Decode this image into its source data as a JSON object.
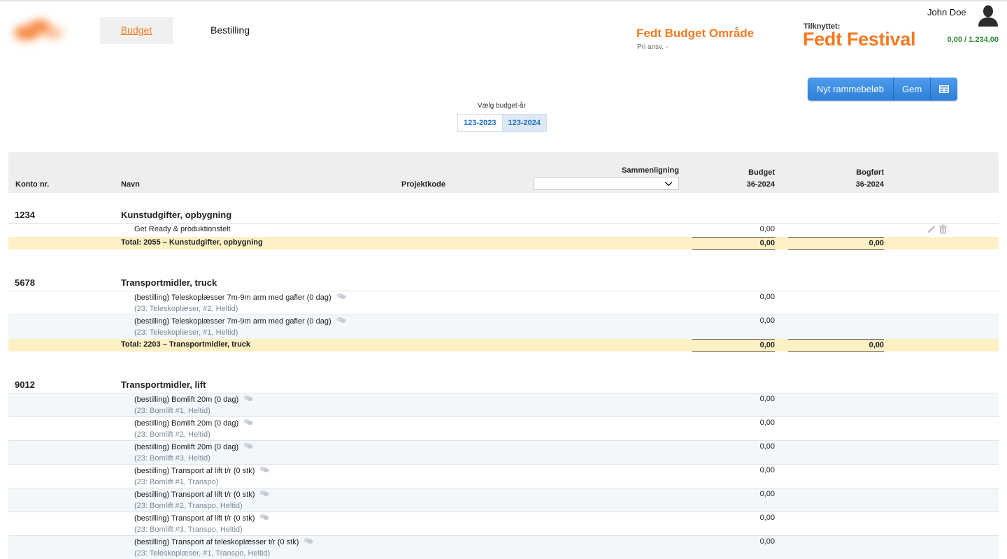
{
  "nav": {
    "tabs": [
      {
        "label": "Budget"
      },
      {
        "label": "Bestilling"
      }
    ]
  },
  "area": {
    "title": "Fedt Budget Område",
    "subtitle": "Pri ansv. -"
  },
  "attached": {
    "label": "Tilknyttet:",
    "name": "Fedt Festival"
  },
  "user": {
    "name": "John Doe",
    "amount": "0,00 / 1.234,00"
  },
  "toolbar": {
    "new_label": "Nyt rammebeløb",
    "save_label": "Gem",
    "table_icon": "table-icon"
  },
  "year": {
    "label": "Vælg budget-år",
    "options": [
      {
        "label": "123-2023"
      },
      {
        "label": "123-2024"
      }
    ],
    "selected": "123-2024"
  },
  "table": {
    "headers": {
      "konto": "Konto nr.",
      "navn": "Navn",
      "projektkode": "Projektkode",
      "sammenligning": "Sammenligning",
      "budget": "Budget",
      "budget_period": "36-2024",
      "bogfort": "Bogført",
      "bogfort_period": "36-2024"
    },
    "comparison_value": "",
    "groups": [
      {
        "no": "1234",
        "name": "Kunstudgifter, opbygning",
        "items": [
          {
            "text": "Get Ready & produktionstelt",
            "value": "0,00"
          }
        ],
        "total": {
          "label": "Total: 2055 – Kunstudgifter, opbygning",
          "budget": "0,00",
          "bogfort": "0,00"
        }
      },
      {
        "no": "5678",
        "name": "Transportmidler, truck",
        "items": [
          {
            "text": "(bestilling) Teleskoplæsser 7m-9m arm med gafler (0 dag)",
            "sub": "(23: Teleskoplæser, #2, Heltid)",
            "value": "0,00"
          },
          {
            "text": "(bestilling) Teleskoplæsser 7m-9m arm med gafler (0 dag)",
            "sub": "(23: Teleskoplæser, #1, Heltid)",
            "value": "0,00"
          }
        ],
        "total": {
          "label": "Total: 2203 – Transportmidler, truck",
          "budget": "0,00",
          "bogfort": "0,00"
        }
      },
      {
        "no": "9012",
        "name": "Transportmidler, lift",
        "items": [
          {
            "text": "(bestilling) Bomlift 20m (0 dag)",
            "sub": "(23: Bomlift #1, Heltid)",
            "value": "0,00"
          },
          {
            "text": "(bestilling) Bomlift 20m (0 dag)",
            "sub": "(23: Bomlift #2, Heltid)",
            "value": "0,00"
          },
          {
            "text": "(bestilling) Bomlift 20m (0 dag)",
            "sub": "(23: Bomlift #3, Heltid)",
            "value": "0,00"
          },
          {
            "text": "(bestilling) Transport af lift t/r (0 stk)",
            "sub": "(23: Bomlift #1, Transpo)",
            "value": "0,00"
          },
          {
            "text": "(bestilling) Transport af lift t/r (0 stk)",
            "sub": "(23: Bomlift #2, Transpo, Heltid)",
            "value": "0,00"
          },
          {
            "text": "(bestilling) Transport af lift t/r (0 stk)",
            "sub": "(23: Bomlift #3, Transpo, Heltid)",
            "value": "0,00"
          },
          {
            "text": "(bestilling) Transport af teleskoplæsser t/r (0 stk)",
            "sub": "(23: Teleskoplæser, #1, Transpo, Heltid)",
            "value": "0,00"
          }
        ]
      }
    ]
  },
  "colors": {
    "accent": "#f47a20",
    "button": "#3a87de",
    "amount": "#2e8b3a",
    "total_row": "#fcf0c4",
    "alt_row": "#f2f7fc"
  }
}
